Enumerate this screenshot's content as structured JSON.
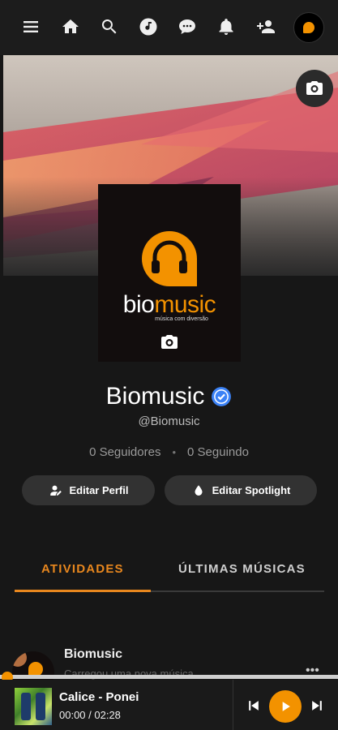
{
  "nav": {
    "icons": [
      "menu-icon",
      "home-icon",
      "search-icon",
      "music-note-icon",
      "chat-icon",
      "bell-icon",
      "add-user-icon"
    ]
  },
  "profile": {
    "brand_part1": "bio",
    "brand_part2": "music",
    "tagline": "música com diversão",
    "name": "Biomusic",
    "handle": "@Biomusic",
    "followers": "0 Seguidores",
    "separator": "•",
    "following": "0 Seguindo"
  },
  "actions": {
    "edit_profile": "Editar Perfil",
    "edit_spotlight": "Editar Spotlight"
  },
  "tabs": {
    "activities": "ATIVIDADES",
    "latest_songs": "ÚLTIMAS MÚSICAS",
    "active": "activities"
  },
  "activity": {
    "name": "Biomusic",
    "description": "Carregou uma nova música",
    "more": "•••"
  },
  "player": {
    "title": "Calice - Ponei",
    "time": "00:00 / 02:28",
    "progress": 0
  },
  "colors": {
    "accent": "#f39200",
    "tab_active": "#e8871e",
    "verified": "#3b82f6",
    "background": "#171717"
  }
}
